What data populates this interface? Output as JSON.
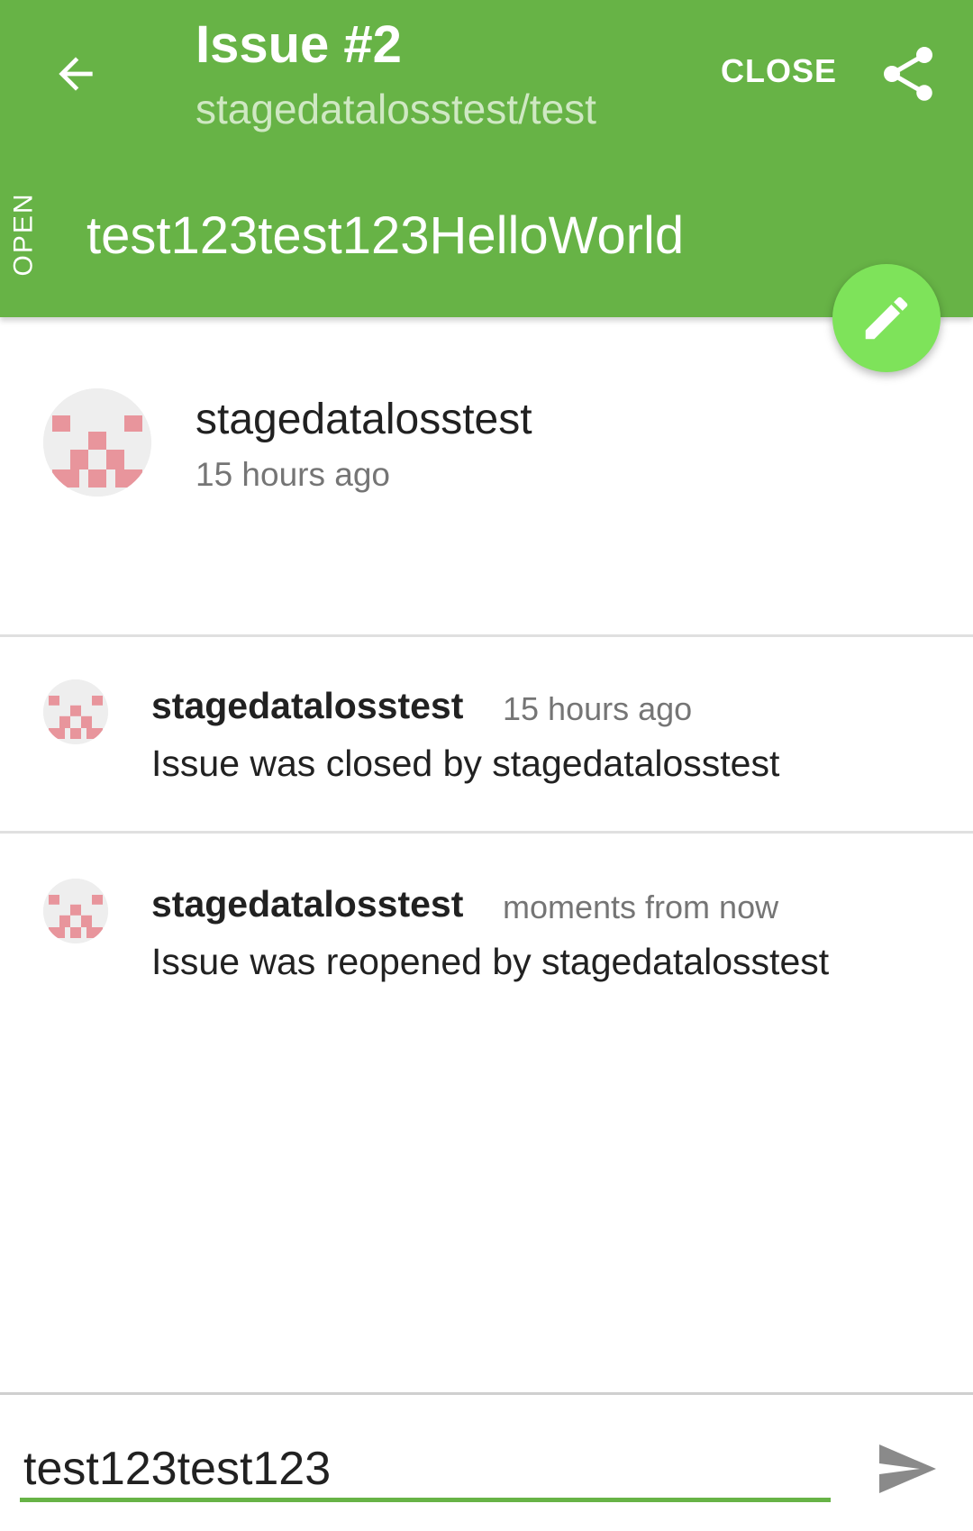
{
  "header": {
    "title": "Issue #2",
    "subtitle": "stagedatalosstest/test",
    "close_label": "CLOSE",
    "state_label": "OPEN",
    "issue_title": "test123test123HelloWorld",
    "back_icon": "arrow-back-icon",
    "share_icon": "share-icon",
    "background_color": "#67b346"
  },
  "fab": {
    "icon": "pencil-icon",
    "color": "#7ee35a"
  },
  "author": {
    "name": "stagedatalosstest",
    "time": "15 hours ago",
    "avatar_color": "#e8959c"
  },
  "events": [
    {
      "user": "stagedatalosstest",
      "time": "15 hours ago",
      "text": "Issue was closed by stagedatalosstest"
    },
    {
      "user": "stagedatalosstest",
      "time": "moments from now",
      "text": "Issue was reopened by stagedatalosstest"
    }
  ],
  "comment_box": {
    "value": "test123test123",
    "send_icon": "send-icon"
  }
}
